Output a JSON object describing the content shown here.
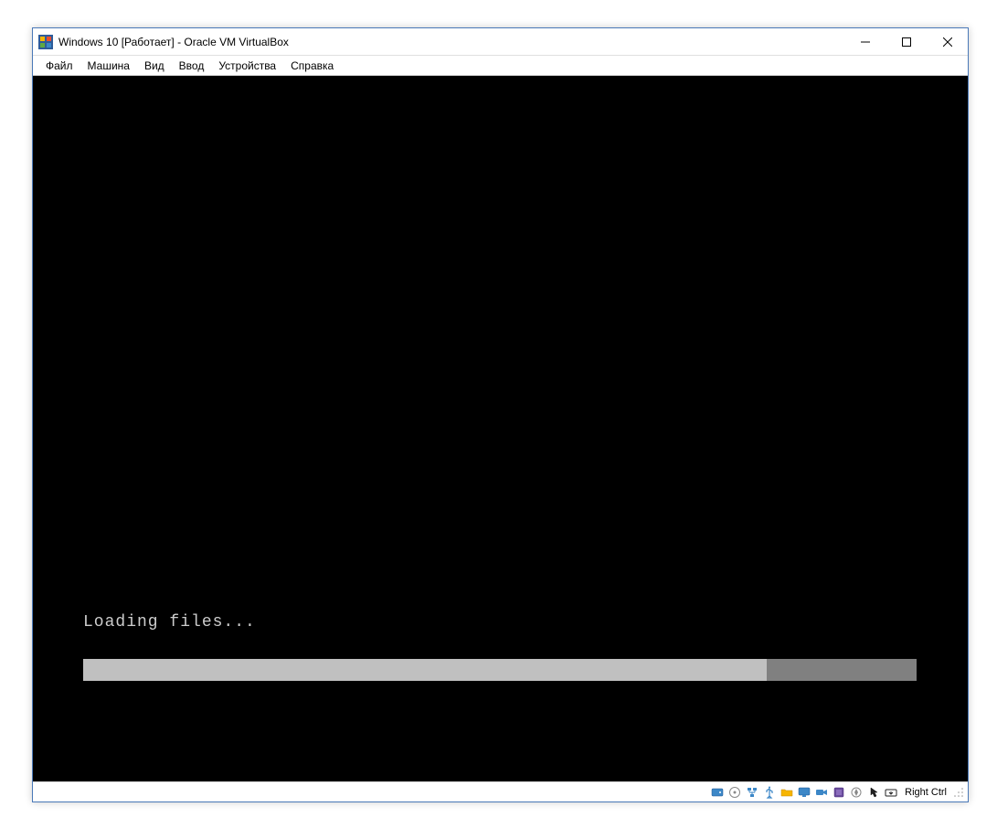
{
  "window": {
    "title": "Windows 10 [Работает] - Oracle VM VirtualBox"
  },
  "menubar": {
    "items": [
      {
        "label": "Файл"
      },
      {
        "label": "Машина"
      },
      {
        "label": "Вид"
      },
      {
        "label": "Ввод"
      },
      {
        "label": "Устройства"
      },
      {
        "label": "Справка"
      }
    ]
  },
  "vm": {
    "loading_text": "Loading files...",
    "progress_percent": 82
  },
  "statusbar": {
    "host_key": "Right Ctrl",
    "icons": [
      "hard-disk-icon",
      "optical-drive-icon",
      "network-icon",
      "usb-icon",
      "shared-folders-icon",
      "display-icon",
      "recording-icon",
      "audio-icon",
      "processor-icon",
      "mouse-capture-icon",
      "host-key-icon"
    ]
  }
}
